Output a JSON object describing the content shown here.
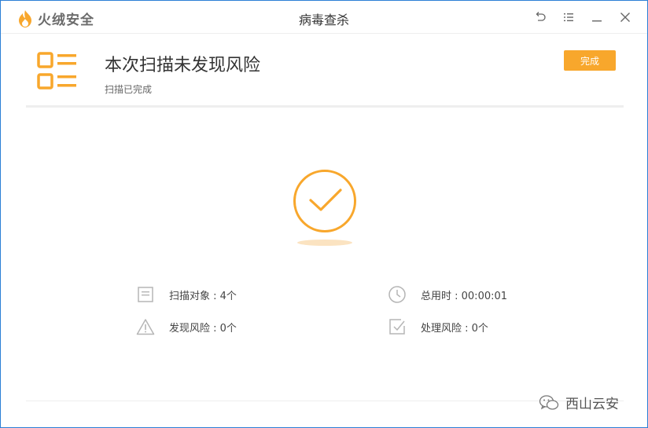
{
  "window": {
    "brand_name": "火绒安全",
    "title": "病毒查杀",
    "controls": [
      "back-icon",
      "menu-icon",
      "minimize-icon",
      "close-icon"
    ]
  },
  "result": {
    "headline": "本次扫描未发现风险",
    "subline": "扫描已完成",
    "done_label": "完成"
  },
  "stats": {
    "scan_objects": "扫描对象 : 4个",
    "total_time": "总用时 : 00:00:01",
    "found_risks": "发现风险 : 0个",
    "handled_risks": "处理风险 : 0个"
  },
  "watermark": {
    "text": "西山云安"
  },
  "colors": {
    "accent": "#f8a72c",
    "window_border": "#2b7fd6",
    "icon_gray": "#b5b5b5"
  }
}
